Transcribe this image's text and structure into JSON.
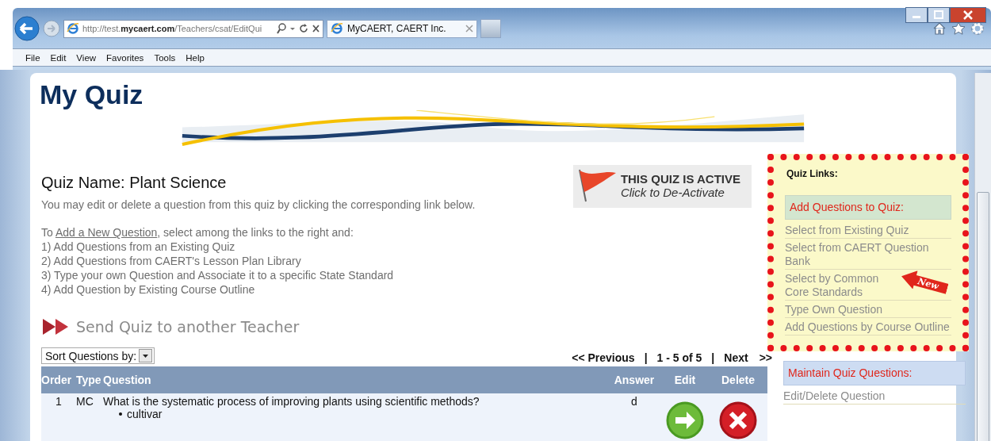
{
  "browser": {
    "address": "http://test.**mycaert.com**/Teachers/csat/EditQui",
    "tab_title": "MyCAERT, CAERT Inc.",
    "menu": [
      "File",
      "Edit",
      "View",
      "Favorites",
      "Tools",
      "Help"
    ]
  },
  "page": {
    "title": "My Quiz",
    "quiz_name": "Quiz Name: Plant Science",
    "active_badge": {
      "title": "THIS QUIZ IS ACTIVE",
      "action": "Click to De-Activate"
    },
    "intro": "You may edit or delete a question from this quiz by clicking the corresponding link below.",
    "add_prefix": "To ",
    "add_link": "Add a New Question",
    "add_suffix": ", select among the links to the right and:",
    "steps": [
      "1) Add Questions from an Existing Quiz",
      "2) Add Questions from CAERT's Lesson Plan Library",
      "3) Type your own Question and Associate it to a specific State Standard",
      "4) Add Question by Existing Course Outline"
    ],
    "send_link": "Send Quiz to another Teacher",
    "sort": {
      "label": "Sort Questions by:"
    },
    "pagination": [
      {
        "kind": "link",
        "text": "<< Previous"
      },
      {
        "kind": "separator",
        "text": "|"
      },
      {
        "kind": "range",
        "text": "1 - 5 of 5"
      },
      {
        "kind": "separator",
        "text": "|"
      },
      {
        "kind": "link",
        "text": "Next"
      },
      {
        "kind": "link",
        "text": ">>"
      }
    ],
    "table": {
      "columns": [
        "Order",
        "Type",
        "Question",
        "Answer",
        "Edit",
        "Delete"
      ],
      "rows": [
        {
          "order": "1",
          "type": "MC",
          "question": "What is the systematic process of improving plants using scientific methods?",
          "options": [
            "cultivar"
          ],
          "answer": "d"
        }
      ]
    }
  },
  "sidebar": {
    "title": "Quiz Links:",
    "sections": [
      {
        "heading": "Add Questions to Quiz:",
        "color": "#d3e6cf",
        "highlighted": true,
        "items": [
          {
            "text": "Select from Existing Quiz"
          },
          {
            "text": "Select from CAERT Question Bank"
          },
          {
            "text": "Select by Common Core Standards",
            "badge": "New"
          },
          {
            "text": "Type Own Question"
          },
          {
            "text": "Add Questions by Course Outline"
          }
        ]
      },
      {
        "heading": "Maintain Quiz Questions:",
        "color": "#cddcf2",
        "highlighted": false,
        "items": [
          {
            "text": "Edit/Delete Question"
          }
        ]
      }
    ]
  }
}
